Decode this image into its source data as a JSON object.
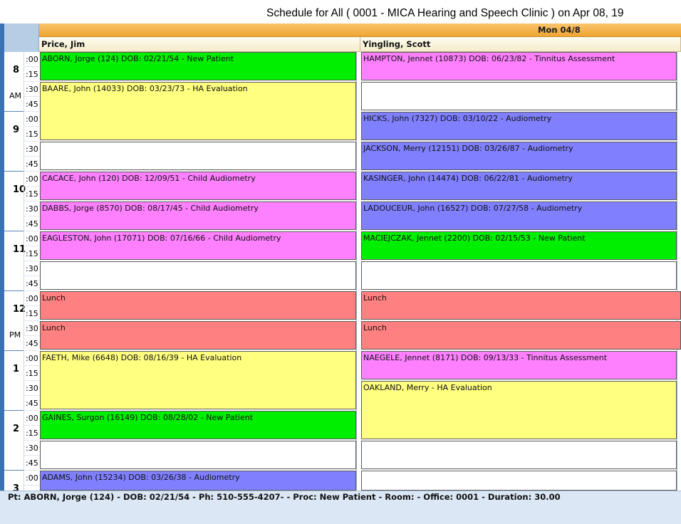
{
  "window": {
    "title": "Schedule for All ( 0001 - MICA Hearing and Speech Clinic ) on Apr 08, 19"
  },
  "header": {
    "date_label": "Mon 04/8"
  },
  "providers": [
    {
      "name": "Price, Jim"
    },
    {
      "name": "Yingling, Scott"
    }
  ],
  "time_column": {
    "hours": [
      {
        "hour": "8",
        "period": "AM",
        "minutes": [
          ":00",
          ":15",
          ":30",
          ":45"
        ]
      },
      {
        "hour": "9",
        "period": "",
        "minutes": [
          ":00",
          ":15",
          ":30",
          ":45"
        ]
      },
      {
        "hour": "10",
        "period": "",
        "minutes": [
          ":00",
          ":15",
          ":30",
          ":45"
        ]
      },
      {
        "hour": "11",
        "period": "",
        "minutes": [
          ":00",
          ":15",
          ":30",
          ":45"
        ]
      },
      {
        "hour": "12",
        "period": "PM",
        "minutes": [
          ":00",
          ":15",
          ":30",
          ":45"
        ]
      },
      {
        "hour": "1",
        "period": "",
        "minutes": [
          ":00",
          ":15",
          ":30",
          ":45"
        ]
      },
      {
        "hour": "2",
        "period": "",
        "minutes": [
          ":00",
          ":15",
          ":30",
          ":45"
        ]
      },
      {
        "hour": "3",
        "period": "",
        "minutes": [
          ":00"
        ]
      }
    ]
  },
  "colors": {
    "new_patient": "#00ee00",
    "ha_evaluation": "#ffff80",
    "child_audiometry": "#ff80ff",
    "tinnitus_assessment": "#ff80ff",
    "audiometry": "#8080ff",
    "lunch": "#ff8080",
    "empty": "#ffffff"
  },
  "schedule": {
    "price": [
      {
        "text": "ABORN, Jorge  (124)  DOB: 02/21/54 -  New Patient",
        "type": "new_patient"
      },
      {
        "text": "BAARE, John  (14033)  DOB: 03/23/73 -  HA Evaluation",
        "type": "ha_evaluation"
      },
      {
        "text": "",
        "type": "empty"
      },
      {
        "text": "CACACE, John  (120)  DOB: 12/09/51 -  Child Audiometry",
        "type": "child_audiometry"
      },
      {
        "text": "DABBS, Jorge  (8570)  DOB: 08/17/45 -  Child Audiometry",
        "type": "child_audiometry"
      },
      {
        "text": "EAGLESTON, John  (17071)  DOB: 07/16/66 -  Child Audiometry",
        "type": "child_audiometry"
      },
      {
        "text": "",
        "type": "empty"
      },
      {
        "text": "Lunch",
        "type": "lunch"
      },
      {
        "text": "Lunch",
        "type": "lunch"
      },
      {
        "text": "FAETH, Mike  (6648)  DOB: 08/16/39 -  HA Evaluation",
        "type": "ha_evaluation"
      },
      {
        "text": "GAINES, Surgon  (16149)  DOB: 08/28/02 -  New Patient",
        "type": "new_patient"
      },
      {
        "text": "",
        "type": "empty"
      },
      {
        "text": "ADAMS, John  (15234)  DOB: 03/26/38 -  Audiometry",
        "type": "audiometry"
      }
    ],
    "yingling": [
      {
        "text": "HAMPTON, Jennet  (10873)  DOB: 06/23/82 -  Tinnitus Assessment",
        "type": "tinnitus_assessment"
      },
      {
        "text": "",
        "type": "empty"
      },
      {
        "text": "HICKS, John  (7327)  DOB: 03/10/22 -  Audiometry",
        "type": "audiometry"
      },
      {
        "text": "JACKSON, Merry  (12151)  DOB: 03/26/87 -  Audiometry",
        "type": "audiometry"
      },
      {
        "text": "KASINGER, John  (14474)  DOB: 06/22/81 -  Audiometry",
        "type": "audiometry"
      },
      {
        "text": "LADOUCEUR, John  (16527)  DOB: 07/27/58 -  Audiometry",
        "type": "audiometry"
      },
      {
        "text": "MACIEJCZAK, Jennet  (2200)  DOB: 02/15/53 -  New Patient",
        "type": "new_patient"
      },
      {
        "text": "",
        "type": "empty"
      },
      {
        "text": "Lunch",
        "type": "lunch"
      },
      {
        "text": "Lunch",
        "type": "lunch"
      },
      {
        "text": "NAEGELE, Jennet  (8171)  DOB: 09/13/33 -  Tinnitus Assessment",
        "type": "tinnitus_assessment"
      },
      {
        "text": "OAKLAND, Merry  -  HA Evaluation",
        "type": "ha_evaluation"
      },
      {
        "text": "",
        "type": "empty"
      },
      {
        "text": "",
        "type": "empty"
      }
    ]
  },
  "status_bar": {
    "text": "Pt: ABORN, Jorge  (124) - DOB: 02/21/54 - Ph: 510-555-4207-  - Proc: New Patient - Room:   - Office: 0001  - Duration: 30.00"
  }
}
